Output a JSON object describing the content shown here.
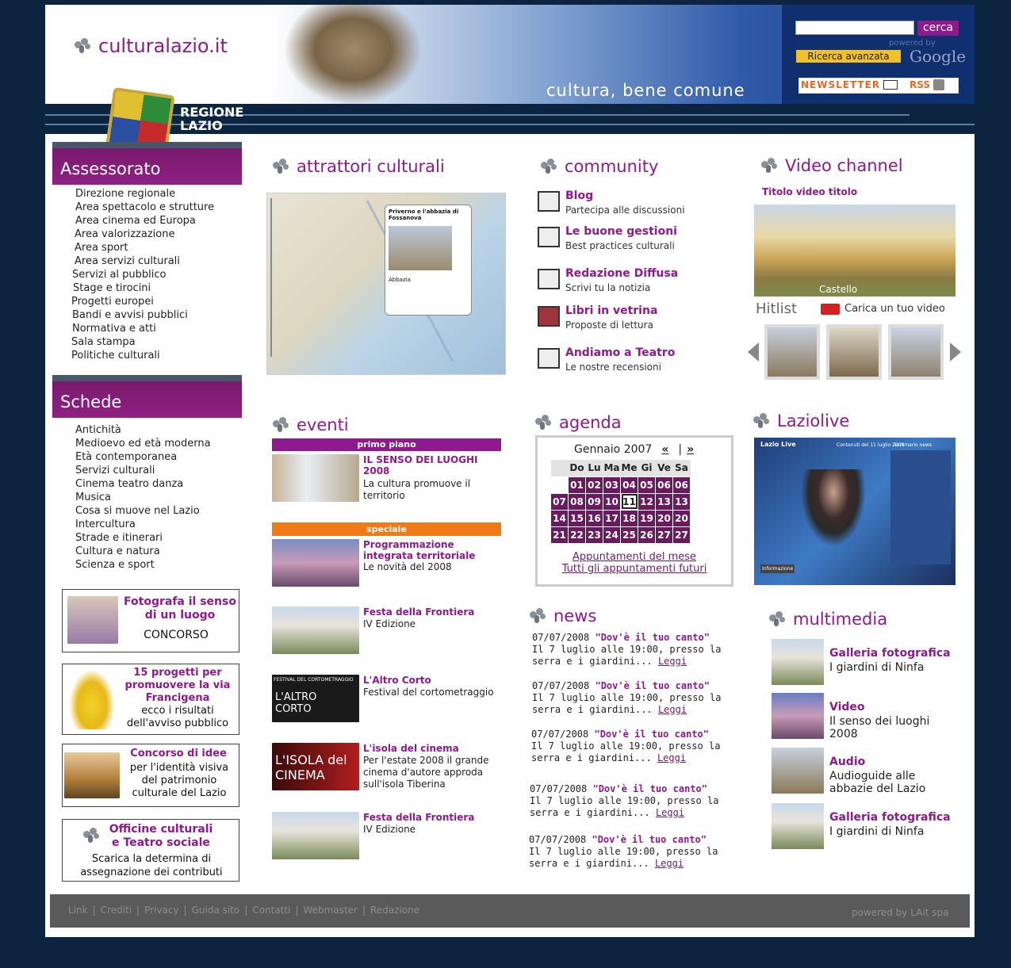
{
  "header": {
    "site_name": "culturalazio.it",
    "tagline": "cultura, bene comune",
    "region": "REGIONE\nLAZIO",
    "region_line1": "REGIONE",
    "region_line2": "LAZIO",
    "search_button": "cerca",
    "advanced_search": "Ricerca avanzata",
    "powered_by_small": "powered by",
    "google": "Google",
    "newsletter": "NEWSLETTER",
    "rss": "RSS"
  },
  "sidebar": {
    "assessorato_title": "Assessorato",
    "assessorato_items": [
      "Direzione regionale",
      "Area spettacolo e strutture",
      "Area cinema ed Europa",
      "Area valorizzazione",
      "Area sport",
      "Area servizi culturali",
      "Servizi al pubblico",
      "Stage e tirocini",
      "Progetti europei",
      "Bandi e avvisi pubblici",
      "Normativa e atti",
      "Sala stampa",
      "Politiche culturali"
    ],
    "schede_title": "Schede",
    "schede_items": [
      "Antichità",
      "Medioevo ed età moderna",
      "Età contemporanea",
      "Servizi culturali",
      "Cinema teatro danza",
      "Musica",
      "Cosa si muove nel Lazio",
      "Intercultura",
      "Strade e itinerari",
      "Cultura e natura",
      "Scienza e sport"
    ],
    "promo1": {
      "title": "Fotografa il senso di un luogo",
      "sub": "CONCORSO"
    },
    "promo2": {
      "title": "15 progetti per promuovere la via Francigena",
      "sub": "ecco i risultati dell'avviso pubblico"
    },
    "promo3": {
      "title": "Concorso di idee",
      "sub": "per l'identità visiva del patrimonio culturale del Lazio"
    },
    "promo4": {
      "title": "Officine culturali e Teatro sociale",
      "sub": "Scarica la determina di assegnazione dei contributi"
    }
  },
  "attrattori": {
    "title": "attrattori culturali",
    "popup_title": "Priverno e l'abbazia di Fossanova",
    "popup_caption": "Abbazia"
  },
  "community": {
    "title": "community",
    "items": [
      {
        "title": "Blog",
        "sub": "Partecipa alle discussioni"
      },
      {
        "title": "Le buone gestioni",
        "sub": "Best practices culturali"
      },
      {
        "title": "Redazione Diffusa",
        "sub": "Scrivi tu la notizia"
      },
      {
        "title": "Libri in vetrina",
        "sub": "Proposte di lettura"
      },
      {
        "title": "Andiamo a Teatro",
        "sub": "Le nostre recensioni"
      }
    ]
  },
  "video": {
    "title": "Video channel",
    "video_title": "Titolo video titolo",
    "caption": "Castello",
    "hitlist": "Hitlist",
    "upload": "Carica un tuo video"
  },
  "eventi": {
    "title": "eventi",
    "primo_piano": "primo piano",
    "speciale": "speciale",
    "items": [
      {
        "title": "IL SENSO DEI LUOGHI 2008",
        "text": "La cultura promuove il territorio"
      },
      {
        "title": "Programmazione integrata territoriale",
        "text": "Le novità del 2008"
      },
      {
        "title": "Festa della Frontiera",
        "text": "IV Edizione"
      },
      {
        "title": "L'Altro Corto",
        "text": "Festival del cortometraggio"
      },
      {
        "title": "L'isola del cinema",
        "text": "Per l'estate 2008 il grande cinema d'autore approda sull'isola Tiberina"
      },
      {
        "title": "Festa della Frontiera",
        "text": "IV Edizione"
      }
    ],
    "altro_corto_img": "L'ALTRO CORTO",
    "altro_corto_small": "FESTIVAL DEL CORTOMETRAGGIO",
    "isola_img": "L'ISOLA del CINEMA"
  },
  "agenda": {
    "title": "agenda",
    "month": "Gennaio 2007",
    "prev": "«",
    "sep": "|",
    "next": "»",
    "days": [
      "Do",
      "Lu",
      "Ma",
      "Me",
      "Gi",
      "Ve",
      "Sa"
    ],
    "weeks": [
      [
        "",
        "01",
        "02",
        "03",
        "04",
        "05",
        "06",
        "06"
      ],
      [
        "07",
        "08",
        "09",
        "10",
        "11",
        "12",
        "13",
        "13"
      ],
      [
        "14",
        "15",
        "16",
        "17",
        "18",
        "19",
        "20",
        "20"
      ],
      [
        "21",
        "22",
        "23",
        "24",
        "25",
        "26",
        "27",
        "27"
      ]
    ],
    "link_month": "Appuntamenti del mese",
    "link_future": "Tutti gli appuntamenti futuri"
  },
  "laziolive": {
    "title": "Laziolive",
    "logo": "Lazio Live",
    "header_text": "Contenuti del 11 luglio 2008",
    "summary": "Sommario news",
    "bottom": "Informazione"
  },
  "news": {
    "title": "news",
    "items": [
      {
        "date": "07/07/2008",
        "title": "\"Dov'è il tuo canto\"",
        "text": "Il 7 luglio alle 19:00, presso la serra e i giardini...",
        "link": "Leggi"
      },
      {
        "date": "07/07/2008",
        "title": "\"Dov'è il tuo canto\"",
        "text": "Il 7 luglio alle 19:00, presso la serra e i giardini...",
        "link": "Leggi"
      },
      {
        "date": "07/07/2008",
        "title": "\"Dov'è il tuo canto\"",
        "text": "Il 7 luglio alle 19:00, presso la serra e i giardini...",
        "link": "Leggi"
      },
      {
        "date": "07/07/2008",
        "title": "\"Dov'è il tuo canto\"",
        "text": "Il 7 luglio alle 19:00, presso la serra e i giardini...",
        "link": "Leggi"
      },
      {
        "date": "07/07/2008",
        "title": "\"Dov'è il tuo canto\"",
        "text": "Il 7 luglio alle 19:00, presso la serra e i giardini...",
        "link": "Leggi"
      }
    ]
  },
  "multimedia": {
    "title": "multimedia",
    "items": [
      {
        "title": "Galleria fotografica",
        "text": "I giardini di Ninfa"
      },
      {
        "title": "Video",
        "text": "Il senso dei luoghi 2008"
      },
      {
        "title": "Audio",
        "text": "Audioguide alle abbazie del Lazio"
      },
      {
        "title": "Galleria fotografica",
        "text": "I giardini di Ninfa"
      }
    ]
  },
  "footer": {
    "links": [
      "Link",
      "Crediti",
      "Privacy",
      "Guida sito",
      "Contatti",
      "Webmaster",
      "Redazione"
    ],
    "sep": "|",
    "powered": "powered by LAit spa"
  }
}
